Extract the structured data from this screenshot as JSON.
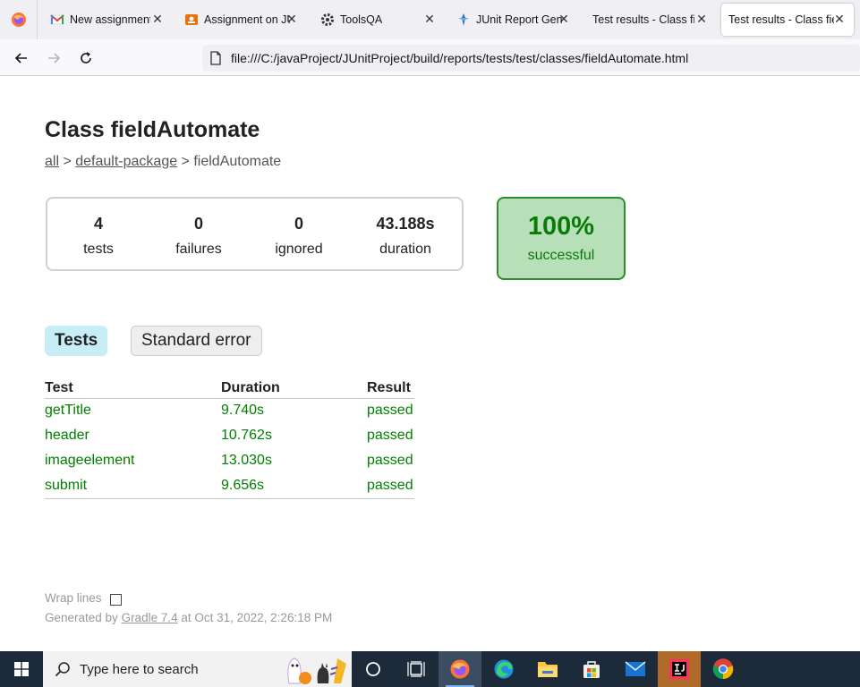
{
  "browser": {
    "tabs": [
      {
        "label": "New assignment"
      },
      {
        "label": "Assignment on JU"
      },
      {
        "label": "ToolsQA"
      },
      {
        "label": "JUnit Report Gene"
      },
      {
        "label": "Test results - Class fiel"
      },
      {
        "label": "Test results - Class fiel",
        "active": true
      }
    ],
    "url": "file:///C:/javaProject/JUnitProject/build/reports/tests/test/classes/fieldAutomate.html"
  },
  "page": {
    "title": "Class fieldAutomate",
    "breadcrumb": {
      "all": "all",
      "sep1": " > ",
      "pkg": "default-package",
      "sep2": " > ",
      "current": "fieldAutomate"
    },
    "summary": {
      "tests": {
        "value": "4",
        "label": "tests"
      },
      "failures": {
        "value": "0",
        "label": "failures"
      },
      "ignored": {
        "value": "0",
        "label": "ignored"
      },
      "duration": {
        "value": "43.188s",
        "label": "duration"
      }
    },
    "success": {
      "percent": "100%",
      "label": "successful"
    },
    "tab_links": {
      "tests": "Tests",
      "stderr": "Standard error"
    },
    "table": {
      "headers": [
        "Test",
        "Duration",
        "Result"
      ],
      "rows": [
        [
          "getTitle",
          "9.740s",
          "passed"
        ],
        [
          "header",
          "10.762s",
          "passed"
        ],
        [
          "imageelement",
          "13.030s",
          "passed"
        ],
        [
          "submit",
          "9.656s",
          "passed"
        ]
      ]
    },
    "footer": {
      "wrap_label": "Wrap lines",
      "gen_prefix": "Generated by ",
      "gen_link": "Gradle 7.4",
      "gen_suffix": " at Oct 31, 2022, 2:26:18 PM"
    }
  },
  "taskbar": {
    "search_placeholder": "Type here to search"
  },
  "colors": {
    "pass_green": "#008000",
    "success_bg": "#b8e0b8",
    "tab_selected": "#c7eef6"
  }
}
